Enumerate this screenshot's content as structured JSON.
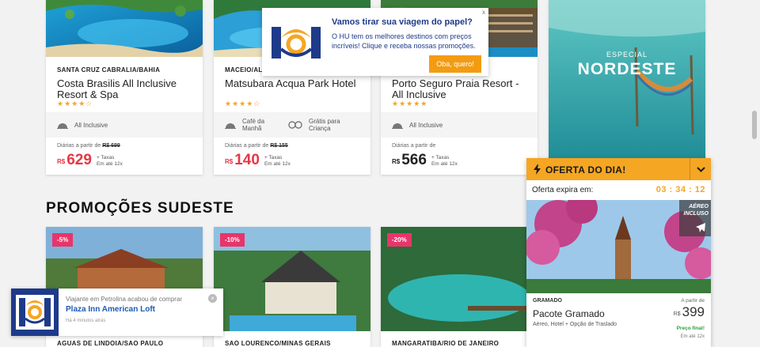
{
  "promo_cards": [
    {
      "location": "SANTA CRUZ CABRALIA/BAHIA",
      "title": "Costa Brasilis All Inclusive Resort & Spa",
      "stars": "★★★★☆",
      "features": [
        "All Inclusive"
      ],
      "daily_label": "Diárias a partir de",
      "old_price": "R$ 699",
      "currency": "R$",
      "price": "629",
      "taxes_line1": "+ Taxas",
      "taxes_line2": "Em até 12x"
    },
    {
      "location": "MACEIO/AL",
      "title": "Matsubara Acqua Park Hotel",
      "stars": "★★★★☆",
      "features": [
        "Café da Manhã",
        "Grátis para Criança"
      ],
      "daily_label": "Diárias a partir de",
      "old_price": "R$ 155",
      "currency": "R$",
      "price": "140",
      "taxes_line1": "+ Taxas",
      "taxes_line2": "Em até 12x"
    },
    {
      "location": "",
      "title": "Porto Seguro Praia Resort - All Inclusive",
      "stars": "★★★★★",
      "features": [
        "All Inclusive"
      ],
      "daily_label": "Diárias a partir de",
      "old_price": "",
      "currency": "R$",
      "price": "566",
      "taxes_line1": "+ Taxas",
      "taxes_line2": "Em até 12x"
    }
  ],
  "banner": {
    "kicker": "ESPECIAL",
    "title": "NORDESTE"
  },
  "section": {
    "title": "PROMOÇÕES SUDESTE"
  },
  "sudeste_cards": [
    {
      "discount": "-5%",
      "location": "AGUAS DE LINDOIA/SAO PAULO"
    },
    {
      "discount": "-10%",
      "location": "SAO LOURENCO/MINAS GERAIS"
    },
    {
      "discount": "-20%",
      "location": "MANGARATIBA/RIO DE JANEIRO"
    }
  ],
  "popup": {
    "heading": "Vamos tirar sua viagem do papel?",
    "body": "O HU tem os melhores destinos com preços incríveis! Clique e receba nossas promoções.",
    "button": "Oba, quero!",
    "close": "x"
  },
  "toast": {
    "line1": "Viajante em Petrolina acabou de comprar",
    "hotel": "Plaza Inn American Loft",
    "time": "Há 4 minutos atrás",
    "close": "×"
  },
  "offer": {
    "label": "OFERTA DO DIA!",
    "expires_label": "Oferta expira em:",
    "timer": "03 : 34 : 12",
    "badge_line1": "AÉREO",
    "badge_line2": "INCLUSO",
    "location": "GRAMADO",
    "title": "Pacote Gramado",
    "subtitle": "Aéreo, Hotel + Opção de Traslado",
    "from_label": "A partir de",
    "currency": "R$",
    "price": "399",
    "final_label": "Preço final!",
    "installments": "Em até 12x"
  },
  "colors": {
    "accent_orange": "#f5a623",
    "price_red": "#e63747",
    "discount_pink": "#e8356a",
    "brand_blue": "#1e3a8a"
  }
}
